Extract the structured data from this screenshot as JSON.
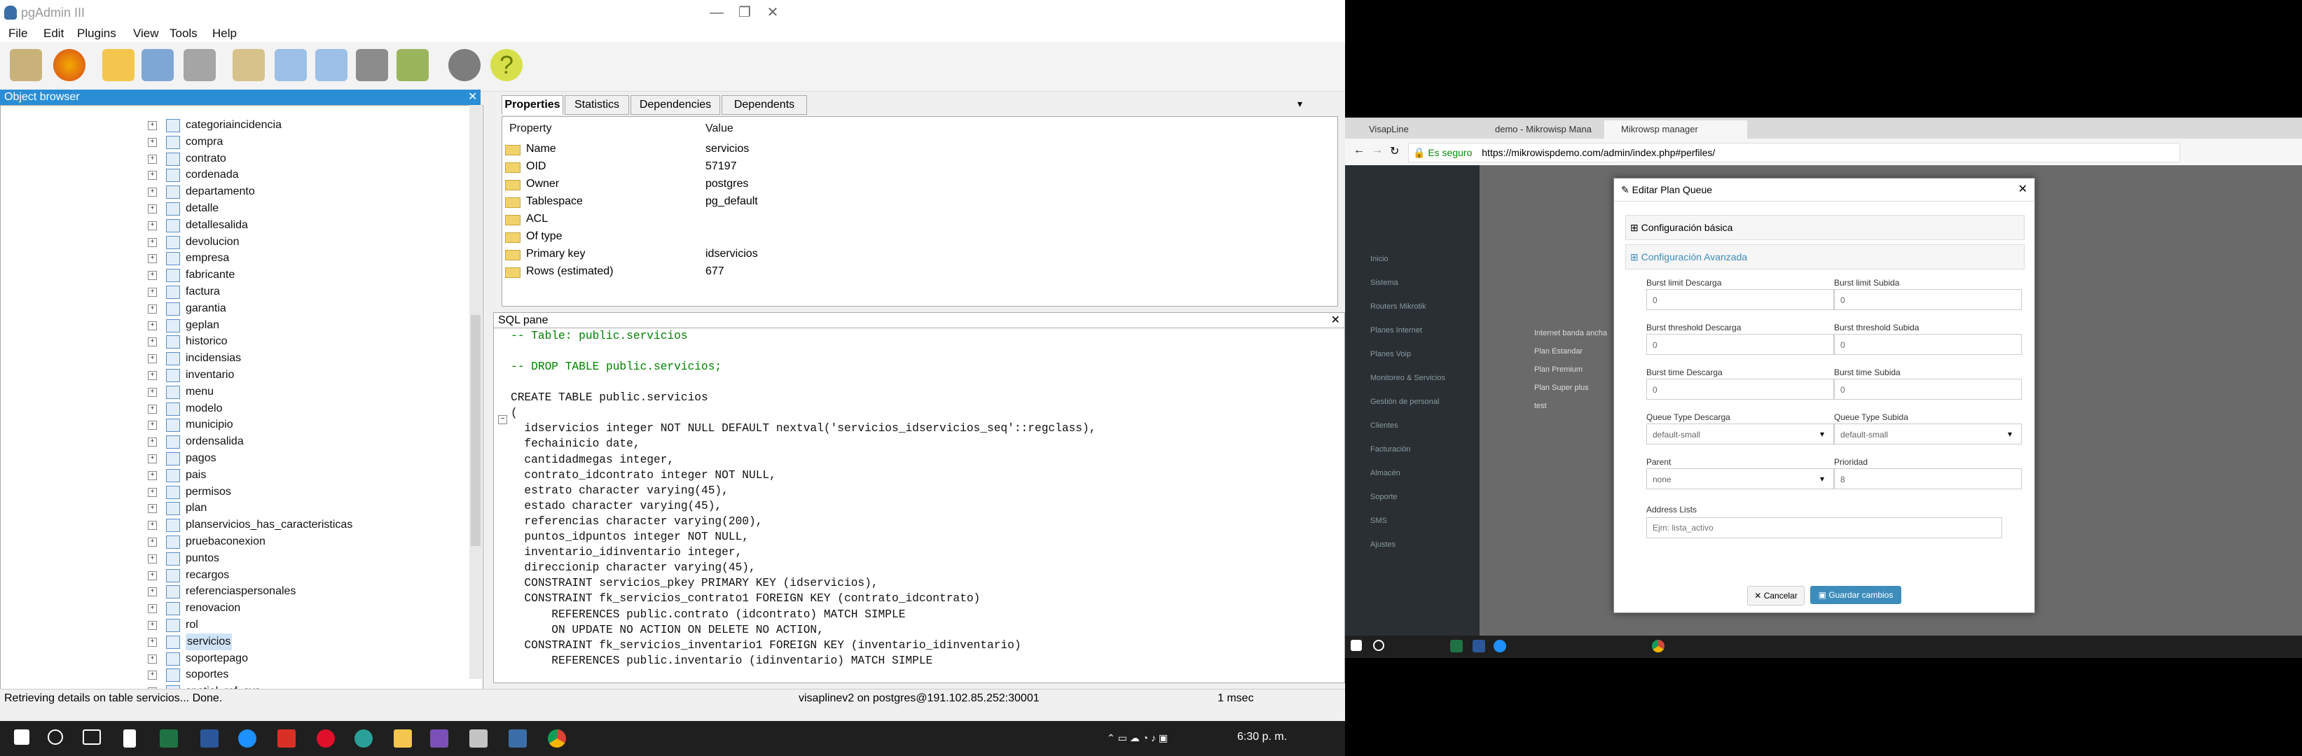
{
  "left": {
    "window_title": "pgAdmin III",
    "menu": [
      "File",
      "Edit",
      "Plugins",
      "View",
      "Tools",
      "Help"
    ],
    "object_browser": {
      "title": "Object browser",
      "items": [
        "categoriaincidencia",
        "compra",
        "contrato",
        "cordenada",
        "departamento",
        "detalle",
        "detallesalida",
        "devolucion",
        "empresa",
        "fabricante",
        "factura",
        "garantia",
        "geplan",
        "historico",
        "incidensias",
        "inventario",
        "menu",
        "modelo",
        "municipio",
        "ordensalida",
        "pagos",
        "pais",
        "permisos",
        "plan",
        "planservicios_has_caracteristicas",
        "pruebaconexion",
        "puntos",
        "recargos",
        "referenciaspersonales",
        "renovacion",
        "rol",
        "servicios",
        "soportepago",
        "soportes",
        "spatial_ref_sys"
      ],
      "selected": "servicios"
    },
    "tabs": [
      "Properties",
      "Statistics",
      "Dependencies",
      "Dependents"
    ],
    "properties": {
      "col_property": "Property",
      "col_value": "Value",
      "rows": [
        {
          "k": "Name",
          "v": "servicios"
        },
        {
          "k": "OID",
          "v": "57197"
        },
        {
          "k": "Owner",
          "v": "postgres"
        },
        {
          "k": "Tablespace",
          "v": "pg_default"
        },
        {
          "k": "ACL",
          "v": ""
        },
        {
          "k": "Of type",
          "v": ""
        },
        {
          "k": "Primary key",
          "v": "idservicios"
        },
        {
          "k": "Rows (estimated)",
          "v": "677"
        }
      ]
    },
    "sql_pane_title": "SQL pane",
    "sql_lines": [
      "-- Table: public.servicios",
      "",
      "-- DROP TABLE public.servicios;",
      "",
      "CREATE TABLE public.servicios",
      "(",
      "  idservicios integer NOT NULL DEFAULT nextval('servicios_idservicios_seq'::regclass),",
      "  fechainicio date,",
      "  cantidadmegas integer,",
      "  contrato_idcontrato integer NOT NULL,",
      "  estrato character varying(45),",
      "  estado character varying(45),",
      "  referencias character varying(200),",
      "  puntos_idpuntos integer NOT NULL,",
      "  inventario_idinventario integer,",
      "  direccionip character varying(45),",
      "  CONSTRAINT servicios_pkey PRIMARY KEY (idservicios),",
      "  CONSTRAINT fk_servicios_contrato1 FOREIGN KEY (contrato_idcontrato)",
      "      REFERENCES public.contrato (idcontrato) MATCH SIMPLE",
      "      ON UPDATE NO ACTION ON DELETE NO ACTION,",
      "  CONSTRAINT fk_servicios_inventario1 FOREIGN KEY (inventario_idinventario)",
      "      REFERENCES public.inventario (idinventario) MATCH SIMPLE"
    ],
    "status": {
      "message": "Retrieving details on table servicios... Done.",
      "connection": "visaplinev2 on postgres@191.102.85.252:30001",
      "time": "1 msec"
    },
    "clock": "6:30 p. m."
  },
  "right": {
    "browser_tabs": [
      "VisapLine",
      "demo - Mikrowisp Mana",
      "Mikrowsp manager"
    ],
    "secure_label": "Es seguro",
    "url": "https://mikrowispdemo.com/admin/index.php#perfiles/",
    "modal": {
      "title": "Editar Plan Queue",
      "section_basic": "Configuración básica",
      "section_adv": "Configuración Avanzada",
      "fields": [
        {
          "label": "Burst limit Descarga",
          "value": "0"
        },
        {
          "label": "Burst limit Subida",
          "value": "0"
        },
        {
          "label": "Burst threshold Descarga",
          "value": "0"
        },
        {
          "label": "Burst threshold Subida",
          "value": "0"
        },
        {
          "label": "Burst time Descarga",
          "value": "0"
        },
        {
          "label": "Burst time Subida",
          "value": "0"
        },
        {
          "label": "Queue Type Descarga",
          "value": "default-small"
        },
        {
          "label": "Queue Type Subida",
          "value": "default-small"
        },
        {
          "label": "Parent",
          "value": "none"
        },
        {
          "label": "Prioridad",
          "value": "8"
        }
      ],
      "address_label": "Address Lists",
      "address_placeholder": "Ejm: lista_activo",
      "cancel": "Cancelar",
      "save": "Guardar cambios"
    },
    "background_menu": [
      "Inicio",
      "Sistema",
      "Routers Mikrotik",
      "Planes Internet",
      "Planes Voip",
      "Monitoreo & Servicios",
      "Gestión de personal",
      "Clientes",
      "Facturación",
      "Almacén",
      "Soporte",
      "SMS",
      "Ajustes"
    ],
    "background_rows": [
      "Internet banda ancha",
      "Plan Estandar",
      "Plan Premium",
      "Plan Super plus",
      "test"
    ]
  },
  "colors": {
    "accent": "#2a8ed6",
    "save_btn": "#3c8dbc",
    "win_taskbar": "#1f1f1f"
  }
}
